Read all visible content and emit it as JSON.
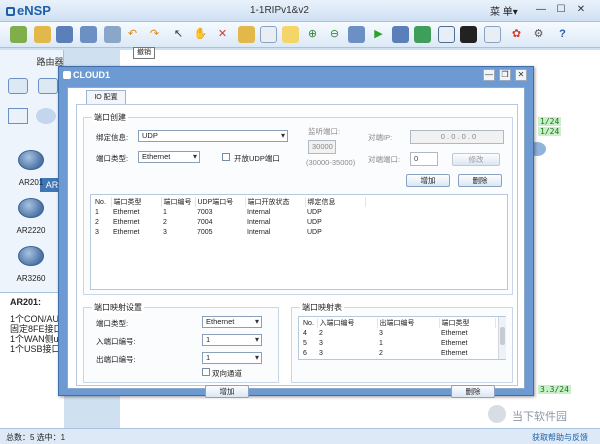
{
  "app": {
    "logo": "eNSP",
    "window_title": "1-1RIPv1&v2",
    "menu_label": "菜 单▾",
    "tooltip": "撤销",
    "toolbar_icons": [
      "new-topo-icon",
      "open-icon",
      "save-icon",
      "save-as-icon",
      "print-icon",
      "undo-icon",
      "redo-icon",
      "select-icon",
      "hand-icon",
      "delete-icon",
      "delete-all-icon",
      "text-icon",
      "rectangle-icon",
      "zoom-in-icon",
      "zoom-out-icon",
      "fit-icon",
      "start-icon",
      "stop-icon",
      "capture-icon",
      "grid-icon",
      "topo-icon",
      "chat-icon",
      "huawei-icon",
      "settings-icon",
      "help-icon"
    ]
  },
  "left_panel": {
    "header": "路由器",
    "tab": "AR",
    "devices": [
      {
        "name": "AR201"
      },
      {
        "name": "AR2220"
      },
      {
        "name": "AR3260"
      }
    ],
    "description": {
      "title": "AR201:",
      "lines": [
        "1个CON/AUX",
        "固定8FE接口",
        "1个WAN侧up",
        "1个USB接口"
      ]
    }
  },
  "canvas": {
    "port_tags": [
      "1/24",
      "1/24",
      "3.3/24"
    ]
  },
  "status": {
    "left": "总数：5  选中：1",
    "right": "获取帮助与反馈"
  },
  "watermark": "当下软件园",
  "cloud": {
    "title": "CLOUD1",
    "tab": "IO 配置",
    "port_create": {
      "title": "端口创建",
      "bind_label": "绑定信息:",
      "bind_value": "UDP",
      "type_label": "端口类型:",
      "type_value": "Ethernet",
      "open_udp_label": "开放UDP端口",
      "listen_label": "监听端口:",
      "listen_value": "30000",
      "listen_hint": "(30000-35000)",
      "peer_ip_label": "对端IP:",
      "peer_ip_value": "0 . 0 . 0 . 0",
      "peer_port_label": "对端端口:",
      "peer_port_value": "0",
      "modify_btn": "修改",
      "add_btn": "增加",
      "delete_btn": "删除",
      "columns": [
        "No.",
        "端口类型",
        "端口编号",
        "UDP端口号",
        "端口开放状态",
        "绑定信息"
      ],
      "rows": [
        [
          "1",
          "Ethernet",
          "1",
          "7003",
          "Internal",
          "UDP"
        ],
        [
          "2",
          "Ethernet",
          "2",
          "7004",
          "Internal",
          "UDP"
        ],
        [
          "3",
          "Ethernet",
          "3",
          "7005",
          "Internal",
          "UDP"
        ]
      ]
    },
    "port_map_settings": {
      "title": "端口映射设置",
      "type_label": "端口类型:",
      "type_value": "Ethernet",
      "in_label": "入端口编号:",
      "in_value": "1",
      "out_label": "出端口编号:",
      "out_value": "1",
      "bidir_label": "双向通道",
      "add_btn": "增加"
    },
    "port_map_table": {
      "title": "端口映射表",
      "columns": [
        "No.",
        "入端口编号",
        "出端口编号",
        "端口类型"
      ],
      "rows": [
        [
          "4",
          "2",
          "3",
          "Ethernet"
        ],
        [
          "5",
          "3",
          "1",
          "Ethernet"
        ],
        [
          "6",
          "3",
          "2",
          "Ethernet"
        ]
      ],
      "delete_btn": "删除"
    }
  }
}
